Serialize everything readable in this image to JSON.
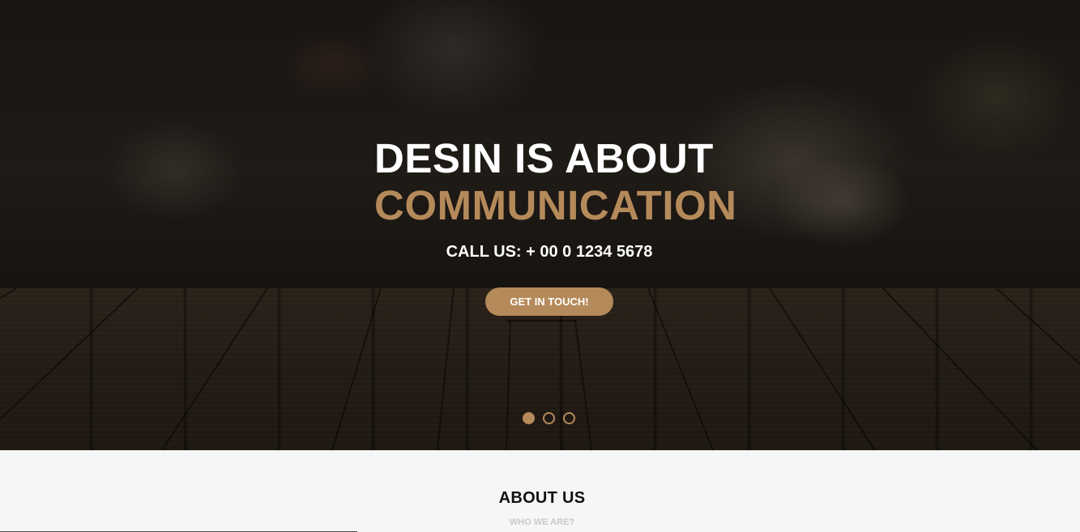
{
  "hero": {
    "headline_line1": "DESIN IS ABOUT",
    "headline_line2": "COMMUNICATION",
    "call_us": "CALL US: + 00 0 1234 5678",
    "cta_label": "GET IN TOUCH!",
    "slides": [
      {
        "active": true
      },
      {
        "active": false
      },
      {
        "active": false
      }
    ],
    "accent_color": "#b58a5a"
  },
  "about": {
    "title": "ABOUT US",
    "subtitle": "WHO WE ARE?"
  }
}
